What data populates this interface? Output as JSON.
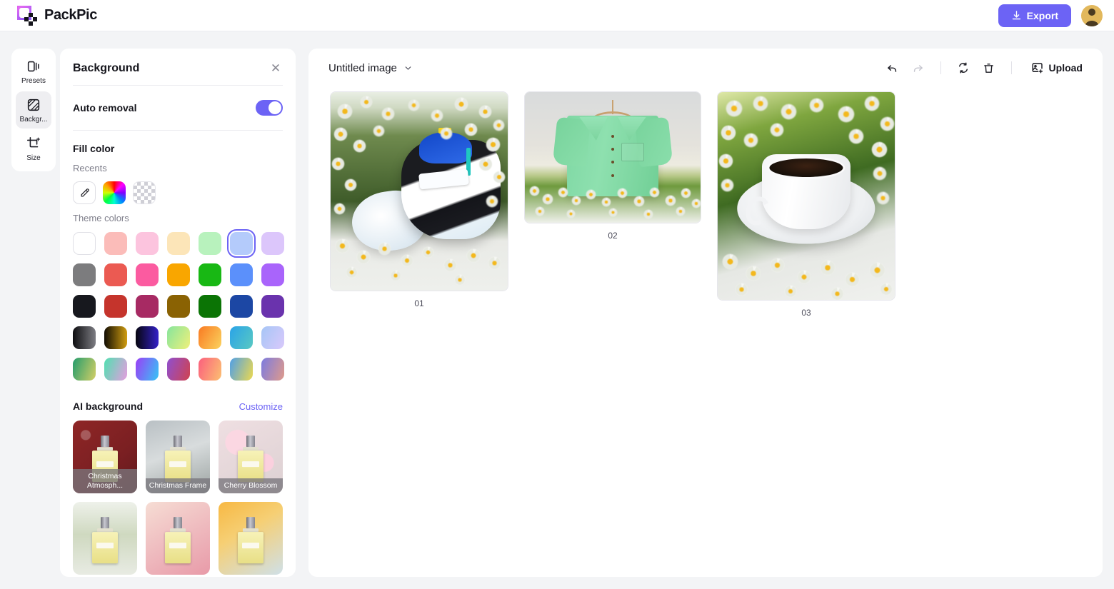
{
  "app": {
    "brand_name": "PackPic",
    "logo_icon": "packpic-logo-icon",
    "export_label": "Export",
    "export_icon": "download-icon",
    "export_color": "#6c63f5",
    "avatar_icon": "user-avatar"
  },
  "rail": {
    "items": [
      {
        "label": "Presets",
        "icon": "presets-icon",
        "active": false
      },
      {
        "label": "Backgr...",
        "icon": "background-icon",
        "active": true
      },
      {
        "label": "Size",
        "icon": "resize-icon",
        "active": false
      }
    ]
  },
  "panel": {
    "title": "Background",
    "close_icon": "close-icon",
    "auto_removal": {
      "label": "Auto removal",
      "enabled": true,
      "toggle_color": "#6c63f5"
    },
    "fill_color": {
      "title": "Fill color",
      "recents_title": "Recents",
      "recents": [
        {
          "name": "eyedropper",
          "type": "tool",
          "icon": "eyedropper-icon"
        },
        {
          "name": "rainbow-picker",
          "type": "gradient"
        },
        {
          "name": "transparent",
          "type": "checker"
        }
      ],
      "theme_title": "Theme colors",
      "theme_colors": [
        {
          "css": "#ffffff",
          "name": "white",
          "white": true,
          "selected": false
        },
        {
          "css": "#fbbcb9",
          "name": "light-salmon",
          "selected": false
        },
        {
          "css": "#fcc4de",
          "name": "light-pink",
          "selected": false
        },
        {
          "css": "#fce5b8",
          "name": "cream",
          "selected": false
        },
        {
          "css": "#b8f2bd",
          "name": "light-green",
          "selected": false
        },
        {
          "css": "#b4cbfb",
          "name": "light-blue",
          "selected": true
        },
        {
          "css": "#dcc6fb",
          "name": "light-lavender",
          "selected": false
        },
        {
          "css": "#7c7c7e",
          "name": "gray",
          "selected": false
        },
        {
          "css": "#eb5a52",
          "name": "red",
          "selected": false
        },
        {
          "css": "#fb5ba0",
          "name": "hot-pink",
          "selected": false
        },
        {
          "css": "#f9a600",
          "name": "orange",
          "selected": false
        },
        {
          "css": "#18b814",
          "name": "green",
          "selected": false
        },
        {
          "css": "#5b90fb",
          "name": "blue",
          "selected": false
        },
        {
          "css": "#a964fb",
          "name": "purple",
          "selected": false
        },
        {
          "css": "#17181e",
          "name": "near-black",
          "selected": false
        },
        {
          "css": "#c5342c",
          "name": "brick-red",
          "selected": false
        },
        {
          "css": "#a72a63",
          "name": "magenta",
          "selected": false
        },
        {
          "css": "#8a6203",
          "name": "dark-gold",
          "selected": false
        },
        {
          "css": "#0b7405",
          "name": "dark-green",
          "selected": false
        },
        {
          "css": "#1c47a4",
          "name": "navy",
          "selected": false
        },
        {
          "css": "#6a33ad",
          "name": "violet",
          "selected": false
        },
        {
          "css": "linear-gradient(90deg,#0d0d10,#7d7d83)",
          "name": "black-gray-gradient",
          "selected": false
        },
        {
          "css": "linear-gradient(90deg,#120d03,#d09d10)",
          "name": "black-gold-gradient",
          "selected": false
        },
        {
          "css": "linear-gradient(90deg,#07060f,#3321c8)",
          "name": "black-indigo-gradient",
          "selected": false
        },
        {
          "css": "linear-gradient(120deg,#86e59d,#f0f07a)",
          "name": "green-yellow-gradient",
          "selected": false
        },
        {
          "css": "linear-gradient(120deg,#f97a22,#fbd35e)",
          "name": "orange-yellow-gradient",
          "selected": false
        },
        {
          "css": "linear-gradient(120deg,#2aa3e8,#59c9c2)",
          "name": "blue-teal-gradient",
          "selected": false
        },
        {
          "css": "linear-gradient(120deg,#a6c6f6,#d9c9fb)",
          "name": "blue-lavender-gradient",
          "selected": false
        },
        {
          "css": "linear-gradient(110deg,#239c6c,#d4cf66)",
          "name": "green-olive-gradient",
          "selected": false
        },
        {
          "css": "linear-gradient(110deg,#4fe0b0,#e79ce0)",
          "name": "teal-pink-gradient",
          "selected": false
        },
        {
          "css": "linear-gradient(110deg,#9b3ef7,#35c6f5)",
          "name": "purple-cyan-gradient",
          "selected": false
        },
        {
          "css": "linear-gradient(110deg,#8f4fd0,#d0434f)",
          "name": "purple-red-gradient",
          "selected": false
        },
        {
          "css": "linear-gradient(110deg,#fb5f7e,#fbc071)",
          "name": "pink-orange-gradient",
          "selected": false
        },
        {
          "css": "linear-gradient(110deg,#4f9fe8,#ecd94f)",
          "name": "blue-yellow-gradient",
          "selected": false
        },
        {
          "css": "linear-gradient(110deg,#7c7be0,#e09a8a)",
          "name": "indigo-salmon-gradient",
          "selected": false
        }
      ]
    },
    "ai_background": {
      "title": "AI background",
      "customize_label": "Customize",
      "customize_color": "#6c63f5",
      "items": [
        {
          "label": "Christmas Atmosph...",
          "scene": "christmas-red"
        },
        {
          "label": "Christmas Frame",
          "scene": "christmas-frame"
        },
        {
          "label": "Cherry Blossom",
          "scene": "cherry-blossom"
        },
        {
          "label": "",
          "scene": "daisy-white"
        },
        {
          "label": "",
          "scene": "pink-tulip"
        },
        {
          "label": "",
          "scene": "orange-sunflower"
        }
      ]
    }
  },
  "canvas": {
    "doc_title": "Untitled image",
    "doc_title_chevron": "chevron-down-icon",
    "toolbar": {
      "undo": {
        "label": "Undo",
        "icon": "undo-icon",
        "disabled": false
      },
      "redo": {
        "label": "Redo",
        "icon": "redo-icon",
        "disabled": true
      },
      "reprocess": {
        "label": "Reprocess",
        "icon": "refresh-icon",
        "disabled": false
      },
      "delete": {
        "label": "Delete",
        "icon": "trash-icon",
        "disabled": false
      },
      "upload": {
        "label": "Upload",
        "icon": "image-plus-icon"
      }
    },
    "images": [
      {
        "number": "01",
        "subject": "sneakers-on-daisy-field"
      },
      {
        "number": "02",
        "subject": "mint-green-shirt-on-hanger"
      },
      {
        "number": "03",
        "subject": "coffee-cup-on-daisy-field"
      }
    ]
  }
}
